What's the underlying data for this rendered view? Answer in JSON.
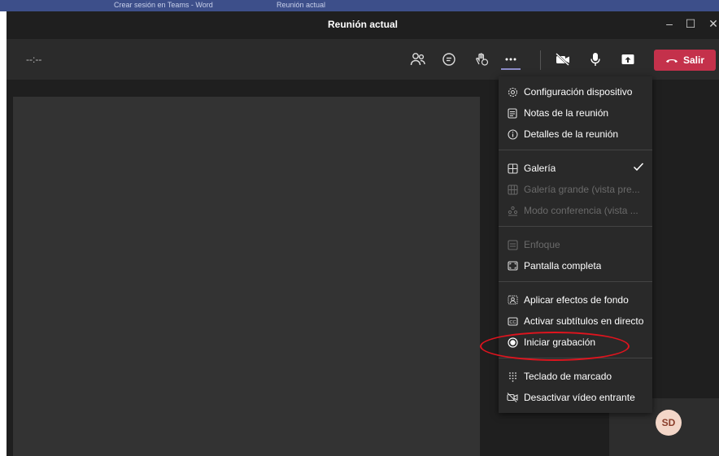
{
  "window": {
    "title": "Reunión actual"
  },
  "taskbar": {
    "item1": "Crear sesión en Teams - Word",
    "item2": "Reunión actual"
  },
  "toolbar": {
    "timer": "--:--",
    "leave_label": "Salir"
  },
  "menu": {
    "items": [
      {
        "label": "Configuración dispositivo",
        "icon": "gear-icon",
        "enabled": true
      },
      {
        "label": "Notas de la reunión",
        "icon": "notes-icon",
        "enabled": true
      },
      {
        "label": "Detalles de la reunión",
        "icon": "info-icon",
        "enabled": true
      },
      {
        "label": "Galería",
        "icon": "grid-icon",
        "enabled": true,
        "checked": true
      },
      {
        "label": "Galería grande (vista pre...",
        "icon": "large-grid-icon",
        "enabled": false
      },
      {
        "label": "Modo conferencia (vista ...",
        "icon": "conference-icon",
        "enabled": false
      },
      {
        "label": "Enfoque",
        "icon": "focus-icon",
        "enabled": false
      },
      {
        "label": "Pantalla completa",
        "icon": "fullscreen-icon",
        "enabled": true
      },
      {
        "label": "Aplicar efectos de fondo",
        "icon": "background-effects-icon",
        "enabled": true
      },
      {
        "label": "Activar subtítulos en directo",
        "icon": "captions-icon",
        "enabled": true
      },
      {
        "label": "Iniciar grabación",
        "icon": "record-icon",
        "enabled": true
      },
      {
        "label": "Teclado de marcado",
        "icon": "dialpad-icon",
        "enabled": true
      },
      {
        "label": "Desactivar vídeo entrante",
        "icon": "video-off-icon",
        "enabled": true
      }
    ]
  },
  "self_view": {
    "initials": "SD"
  },
  "colors": {
    "leave": "#c4314b",
    "accent": "#8b8cc7",
    "highlight": "#e0141e"
  }
}
